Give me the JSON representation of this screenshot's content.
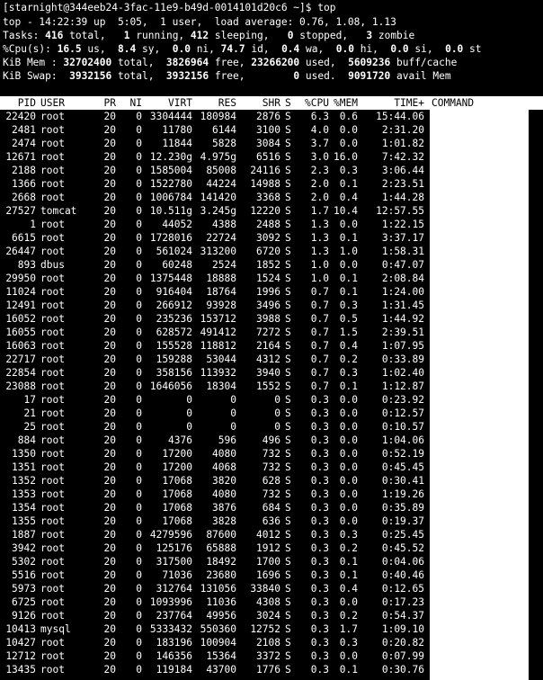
{
  "prompt": "[starnight@344eeb24-3fac-11e9-b49d-0014101d20c6 ~]$ top",
  "summary": {
    "top_line": "top - 14:22:39 up  5:05,  1 user,  load average: 0.76, 1.08, 1.13",
    "tasks": {
      "label": "Tasks:",
      "total": "416",
      "total_label": "total,",
      "running": "1",
      "running_label": "running,",
      "sleeping": "412",
      "sleeping_label": "sleeping,",
      "stopped": "0",
      "stopped_label": "stopped,",
      "zombie": "3",
      "zombie_label": "zombie"
    },
    "cpu": {
      "label": "%Cpu(s):",
      "us": "16.5",
      "us_label": "us,",
      "sy": "8.4",
      "sy_label": "sy,",
      "ni": "0.0",
      "ni_label": "ni,",
      "id": "74.7",
      "id_label": "id,",
      "wa": "0.4",
      "wa_label": "wa,",
      "hi": "0.0",
      "hi_label": "hi,",
      "si": "0.0",
      "si_label": "si,",
      "st": "0.0",
      "st_label": "st"
    },
    "mem": {
      "label": "KiB Mem :",
      "total": "32702400",
      "total_label": "total,",
      "free": "3826964",
      "free_label": "free,",
      "used": "23266200",
      "used_label": "used,",
      "buff": "5609236",
      "buff_label": "buff/cache"
    },
    "swap": {
      "label": "KiB Swap:",
      "total": "3932156",
      "total_label": "total,",
      "free": "3932156",
      "free_label": "free,",
      "used": "0",
      "used_label": "used.",
      "avail": "9091720",
      "avail_label": "avail Mem"
    }
  },
  "columns": {
    "pid": "PID",
    "user": "USER",
    "pr": "PR",
    "ni": "NI",
    "virt": "VIRT",
    "res": "RES",
    "shr": "SHR",
    "s": "S",
    "cpu": "%CPU",
    "mem": "%MEM",
    "time": "TIME+",
    "command": "COMMAND"
  },
  "processes": [
    {
      "pid": "22420",
      "user": "root",
      "pr": "20",
      "ni": "0",
      "virt": "3304444",
      "res": "180984",
      "shr": "2876",
      "s": "S",
      "cpu": "6.3",
      "mem": "0.6",
      "time": "15:44.06"
    },
    {
      "pid": "2481",
      "user": "root",
      "pr": "20",
      "ni": "0",
      "virt": "11780",
      "res": "6144",
      "shr": "3100",
      "s": "S",
      "cpu": "4.0",
      "mem": "0.0",
      "time": "2:31.20"
    },
    {
      "pid": "2474",
      "user": "root",
      "pr": "20",
      "ni": "0",
      "virt": "11844",
      "res": "5828",
      "shr": "3084",
      "s": "S",
      "cpu": "3.7",
      "mem": "0.0",
      "time": "1:01.82"
    },
    {
      "pid": "12671",
      "user": "root",
      "pr": "20",
      "ni": "0",
      "virt": "12.230g",
      "res": "4.975g",
      "shr": "6516",
      "s": "S",
      "cpu": "3.0",
      "mem": "16.0",
      "time": "7:42.32"
    },
    {
      "pid": "2188",
      "user": "root",
      "pr": "20",
      "ni": "0",
      "virt": "1585004",
      "res": "85008",
      "shr": "24116",
      "s": "S",
      "cpu": "2.3",
      "mem": "0.3",
      "time": "3:06.44"
    },
    {
      "pid": "1366",
      "user": "root",
      "pr": "20",
      "ni": "0",
      "virt": "1522780",
      "res": "44224",
      "shr": "14988",
      "s": "S",
      "cpu": "2.0",
      "mem": "0.1",
      "time": "2:23.51"
    },
    {
      "pid": "2668",
      "user": "root",
      "pr": "20",
      "ni": "0",
      "virt": "1006784",
      "res": "141420",
      "shr": "3368",
      "s": "S",
      "cpu": "2.0",
      "mem": "0.4",
      "time": "1:44.28"
    },
    {
      "pid": "27527",
      "user": "tomcat",
      "pr": "20",
      "ni": "0",
      "virt": "10.511g",
      "res": "3.245g",
      "shr": "12220",
      "s": "S",
      "cpu": "1.7",
      "mem": "10.4",
      "time": "12:57.55"
    },
    {
      "pid": "1",
      "user": "root",
      "pr": "20",
      "ni": "0",
      "virt": "44052",
      "res": "4388",
      "shr": "2488",
      "s": "S",
      "cpu": "1.3",
      "mem": "0.0",
      "time": "1:22.15"
    },
    {
      "pid": "6615",
      "user": "root",
      "pr": "20",
      "ni": "0",
      "virt": "1728016",
      "res": "22724",
      "shr": "3092",
      "s": "S",
      "cpu": "1.3",
      "mem": "0.1",
      "time": "3:37.17"
    },
    {
      "pid": "26447",
      "user": "root",
      "pr": "20",
      "ni": "0",
      "virt": "561024",
      "res": "313200",
      "shr": "6720",
      "s": "S",
      "cpu": "1.3",
      "mem": "1.0",
      "time": "1:58.31"
    },
    {
      "pid": "893",
      "user": "dbus",
      "pr": "20",
      "ni": "0",
      "virt": "60248",
      "res": "2524",
      "shr": "1852",
      "s": "S",
      "cpu": "1.0",
      "mem": "0.0",
      "time": "0:47.07"
    },
    {
      "pid": "29950",
      "user": "root",
      "pr": "20",
      "ni": "0",
      "virt": "1375448",
      "res": "18888",
      "shr": "1524",
      "s": "S",
      "cpu": "1.0",
      "mem": "0.1",
      "time": "2:08.84"
    },
    {
      "pid": "11024",
      "user": "root",
      "pr": "20",
      "ni": "0",
      "virt": "916404",
      "res": "18764",
      "shr": "1996",
      "s": "S",
      "cpu": "0.7",
      "mem": "0.1",
      "time": "1:24.00"
    },
    {
      "pid": "12491",
      "user": "root",
      "pr": "20",
      "ni": "0",
      "virt": "266912",
      "res": "93928",
      "shr": "3496",
      "s": "S",
      "cpu": "0.7",
      "mem": "0.3",
      "time": "1:31.45"
    },
    {
      "pid": "16052",
      "user": "root",
      "pr": "20",
      "ni": "0",
      "virt": "235236",
      "res": "153712",
      "shr": "3988",
      "s": "S",
      "cpu": "0.7",
      "mem": "0.5",
      "time": "1:44.92"
    },
    {
      "pid": "16055",
      "user": "root",
      "pr": "20",
      "ni": "0",
      "virt": "628572",
      "res": "491412",
      "shr": "7272",
      "s": "S",
      "cpu": "0.7",
      "mem": "1.5",
      "time": "2:39.51"
    },
    {
      "pid": "16063",
      "user": "root",
      "pr": "20",
      "ni": "0",
      "virt": "155528",
      "res": "118812",
      "shr": "2164",
      "s": "S",
      "cpu": "0.7",
      "mem": "0.4",
      "time": "1:07.95"
    },
    {
      "pid": "22717",
      "user": "root",
      "pr": "20",
      "ni": "0",
      "virt": "159288",
      "res": "53044",
      "shr": "4312",
      "s": "S",
      "cpu": "0.7",
      "mem": "0.2",
      "time": "0:33.89"
    },
    {
      "pid": "22854",
      "user": "root",
      "pr": "20",
      "ni": "0",
      "virt": "358156",
      "res": "113932",
      "shr": "3940",
      "s": "S",
      "cpu": "0.7",
      "mem": "0.3",
      "time": "1:02.40"
    },
    {
      "pid": "23088",
      "user": "root",
      "pr": "20",
      "ni": "0",
      "virt": "1646056",
      "res": "18304",
      "shr": "1552",
      "s": "S",
      "cpu": "0.7",
      "mem": "0.1",
      "time": "1:12.87"
    },
    {
      "pid": "17",
      "user": "root",
      "pr": "20",
      "ni": "0",
      "virt": "0",
      "res": "0",
      "shr": "0",
      "s": "S",
      "cpu": "0.3",
      "mem": "0.0",
      "time": "0:23.92"
    },
    {
      "pid": "21",
      "user": "root",
      "pr": "20",
      "ni": "0",
      "virt": "0",
      "res": "0",
      "shr": "0",
      "s": "S",
      "cpu": "0.3",
      "mem": "0.0",
      "time": "0:12.57"
    },
    {
      "pid": "25",
      "user": "root",
      "pr": "20",
      "ni": "0",
      "virt": "0",
      "res": "0",
      "shr": "0",
      "s": "S",
      "cpu": "0.3",
      "mem": "0.0",
      "time": "0:10.57"
    },
    {
      "pid": "884",
      "user": "root",
      "pr": "20",
      "ni": "0",
      "virt": "4376",
      "res": "596",
      "shr": "496",
      "s": "S",
      "cpu": "0.3",
      "mem": "0.0",
      "time": "1:04.06"
    },
    {
      "pid": "1350",
      "user": "root",
      "pr": "20",
      "ni": "0",
      "virt": "17200",
      "res": "4080",
      "shr": "732",
      "s": "S",
      "cpu": "0.3",
      "mem": "0.0",
      "time": "0:52.19"
    },
    {
      "pid": "1351",
      "user": "root",
      "pr": "20",
      "ni": "0",
      "virt": "17200",
      "res": "4068",
      "shr": "732",
      "s": "S",
      "cpu": "0.3",
      "mem": "0.0",
      "time": "0:45.45"
    },
    {
      "pid": "1352",
      "user": "root",
      "pr": "20",
      "ni": "0",
      "virt": "17068",
      "res": "3820",
      "shr": "628",
      "s": "S",
      "cpu": "0.3",
      "mem": "0.0",
      "time": "0:30.41"
    },
    {
      "pid": "1353",
      "user": "root",
      "pr": "20",
      "ni": "0",
      "virt": "17068",
      "res": "4080",
      "shr": "732",
      "s": "S",
      "cpu": "0.3",
      "mem": "0.0",
      "time": "1:19.26"
    },
    {
      "pid": "1354",
      "user": "root",
      "pr": "20",
      "ni": "0",
      "virt": "17068",
      "res": "3876",
      "shr": "684",
      "s": "S",
      "cpu": "0.3",
      "mem": "0.0",
      "time": "0:35.89"
    },
    {
      "pid": "1355",
      "user": "root",
      "pr": "20",
      "ni": "0",
      "virt": "17068",
      "res": "3828",
      "shr": "636",
      "s": "S",
      "cpu": "0.3",
      "mem": "0.0",
      "time": "0:19.37"
    },
    {
      "pid": "1887",
      "user": "root",
      "pr": "20",
      "ni": "0",
      "virt": "4279596",
      "res": "87600",
      "shr": "4012",
      "s": "S",
      "cpu": "0.3",
      "mem": "0.3",
      "time": "0:25.45"
    },
    {
      "pid": "3942",
      "user": "root",
      "pr": "20",
      "ni": "0",
      "virt": "125176",
      "res": "65888",
      "shr": "1912",
      "s": "S",
      "cpu": "0.3",
      "mem": "0.2",
      "time": "0:45.52"
    },
    {
      "pid": "5302",
      "user": "root",
      "pr": "20",
      "ni": "0",
      "virt": "317500",
      "res": "18492",
      "shr": "1700",
      "s": "S",
      "cpu": "0.3",
      "mem": "0.1",
      "time": "0:04.06"
    },
    {
      "pid": "5516",
      "user": "root",
      "pr": "20",
      "ni": "0",
      "virt": "71036",
      "res": "23680",
      "shr": "1696",
      "s": "S",
      "cpu": "0.3",
      "mem": "0.1",
      "time": "0:40.46"
    },
    {
      "pid": "5973",
      "user": "root",
      "pr": "20",
      "ni": "0",
      "virt": "312764",
      "res": "131056",
      "shr": "33840",
      "s": "S",
      "cpu": "0.3",
      "mem": "0.4",
      "time": "0:12.65"
    },
    {
      "pid": "6725",
      "user": "root",
      "pr": "20",
      "ni": "0",
      "virt": "1093996",
      "res": "11036",
      "shr": "4308",
      "s": "S",
      "cpu": "0.3",
      "mem": "0.0",
      "time": "0:17.23"
    },
    {
      "pid": "9126",
      "user": "root",
      "pr": "20",
      "ni": "0",
      "virt": "237764",
      "res": "49956",
      "shr": "3024",
      "s": "S",
      "cpu": "0.3",
      "mem": "0.2",
      "time": "0:54.37"
    },
    {
      "pid": "10413",
      "user": "mysql",
      "pr": "20",
      "ni": "0",
      "virt": "5333432",
      "res": "550360",
      "shr": "12752",
      "s": "S",
      "cpu": "0.3",
      "mem": "1.7",
      "time": "1:09.10"
    },
    {
      "pid": "10427",
      "user": "root",
      "pr": "20",
      "ni": "0",
      "virt": "183196",
      "res": "100904",
      "shr": "2108",
      "s": "S",
      "cpu": "0.3",
      "mem": "0.3",
      "time": "0:20.82"
    },
    {
      "pid": "12712",
      "user": "root",
      "pr": "20",
      "ni": "0",
      "virt": "146356",
      "res": "15364",
      "shr": "3372",
      "s": "S",
      "cpu": "0.3",
      "mem": "0.0",
      "time": "0:07.99"
    },
    {
      "pid": "13435",
      "user": "root",
      "pr": "20",
      "ni": "0",
      "virt": "119184",
      "res": "43700",
      "shr": "1776",
      "s": "S",
      "cpu": "0.3",
      "mem": "0.1",
      "time": "0:30.76"
    }
  ]
}
